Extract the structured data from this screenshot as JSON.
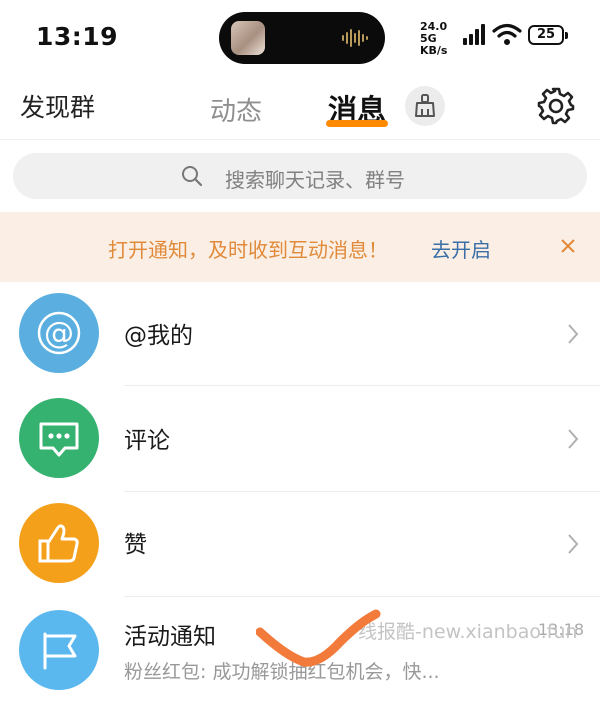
{
  "status_bar": {
    "time": "13:19",
    "net_speed_line1": "24.0 5G",
    "net_speed_line2": "KB/s",
    "battery": "25"
  },
  "header": {
    "left_label": "发现群",
    "tabs": [
      {
        "label": "动态",
        "active": false
      },
      {
        "label": "消息",
        "active": true
      }
    ],
    "accent_color": "#ff8a00"
  },
  "search": {
    "placeholder": "搜索聊天记录、群号"
  },
  "notify_banner": {
    "text": "打开通知，及时收到互动消息！",
    "link": "去开启"
  },
  "items": [
    {
      "title": "@我的",
      "icon": "at-icon",
      "color": "#5aafe0"
    },
    {
      "title": "评论",
      "icon": "comment-icon",
      "color": "#35b26f"
    },
    {
      "title": "赞",
      "icon": "thumbs-up-icon",
      "color": "#f5a01a"
    },
    {
      "title": "活动通知",
      "icon": "flag-icon",
      "color": "#5bb8ef",
      "subtitle": "粉丝红包: 成功解锁抽红包机会，快...",
      "time": "13:18"
    }
  ],
  "watermark": "线报酷-new.xianbao.fun"
}
